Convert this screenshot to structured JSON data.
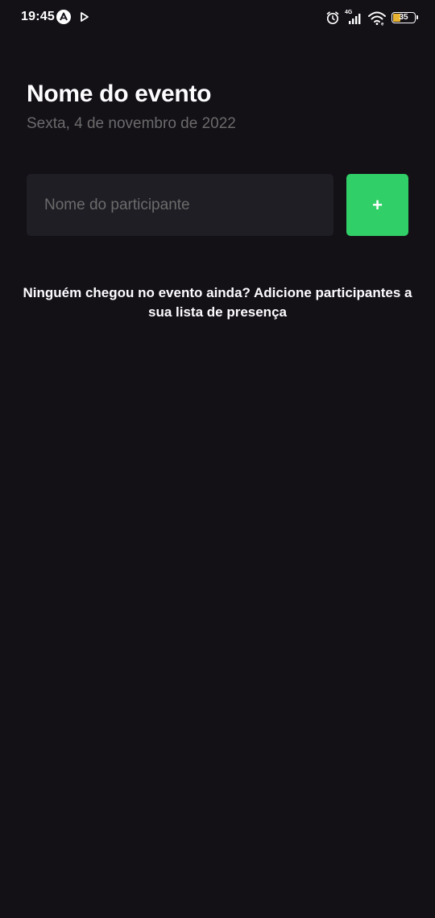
{
  "status_bar": {
    "time": "19:45",
    "network_type": "4G",
    "battery_level": "35",
    "icons": [
      "app-a-icon",
      "play-store-icon",
      "alarm-icon",
      "signal-icon",
      "wifi-icon",
      "battery-icon"
    ]
  },
  "event": {
    "title": "Nome do evento",
    "date": "Sexta, 4 de novembro de 2022"
  },
  "form": {
    "participant_placeholder": "Nome do participante",
    "participant_value": "",
    "add_button_label": "+"
  },
  "empty_state": {
    "message": "Ninguém chegou no evento ainda? Adicione participantes a sua lista de presença"
  },
  "colors": {
    "background": "#131016",
    "input_background": "#1F1E25",
    "muted_text": "#6B6B6B",
    "accent_green": "#31CF67",
    "text": "#FDFCFE"
  }
}
